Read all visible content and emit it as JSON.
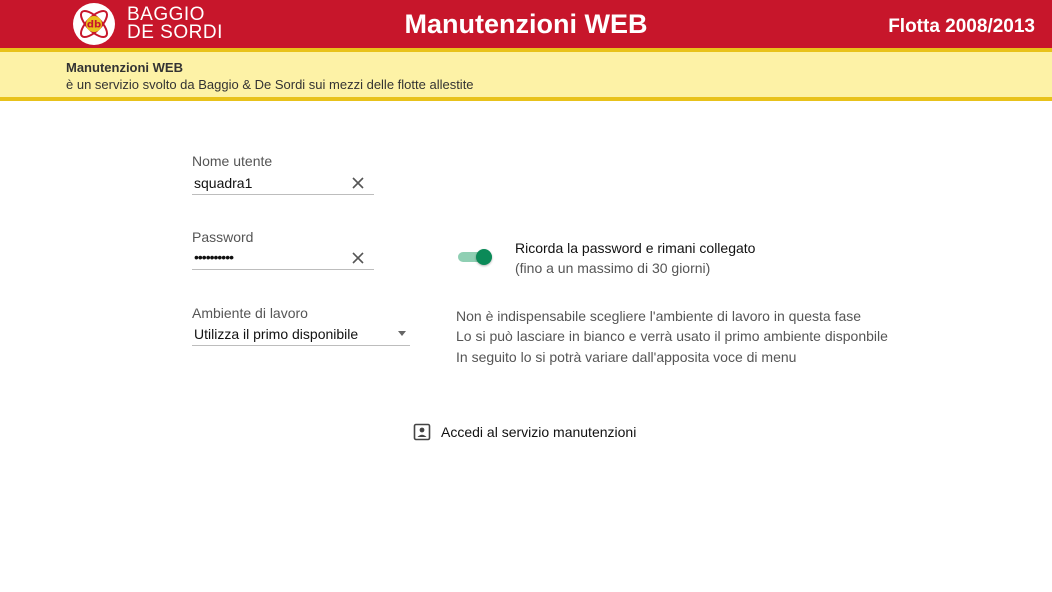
{
  "header": {
    "brand_line1": "BAGGIO",
    "brand_line2": "DE SORDI",
    "title": "Manutenzioni WEB",
    "fleet": "Flotta 2008/2013",
    "logo_text": "db"
  },
  "banner": {
    "title": "Manutenzioni WEB",
    "subtitle": "è un servizio svolto da Baggio & De Sordi sui mezzi delle flotte allestite"
  },
  "form": {
    "username_label": "Nome utente",
    "username_value": "squadra1",
    "password_label": "Password",
    "password_value": "••••••••••",
    "environment_label": "Ambiente di lavoro",
    "environment_value": "Utilizza il primo disponibile"
  },
  "remember": {
    "label": "Ricorda la password e rimani collegato",
    "sublabel": "(fino a un massimo di 30 giorni)",
    "enabled": true
  },
  "info_lines": [
    "Non è indispensabile scegliere l'ambiente di lavoro in questa fase",
    "Lo si può lasciare in bianco e verrà usato il primo ambiente disponbile",
    "In seguito lo si potrà variare dall'apposita voce di menu"
  ],
  "login": {
    "label": "Accedi al servizio manutenzioni"
  },
  "colors": {
    "header_red": "#c7162b",
    "accent_yellow": "#e8c21a",
    "banner_yellow": "#fdf2a6",
    "toggle_green": "#0b8a58"
  }
}
